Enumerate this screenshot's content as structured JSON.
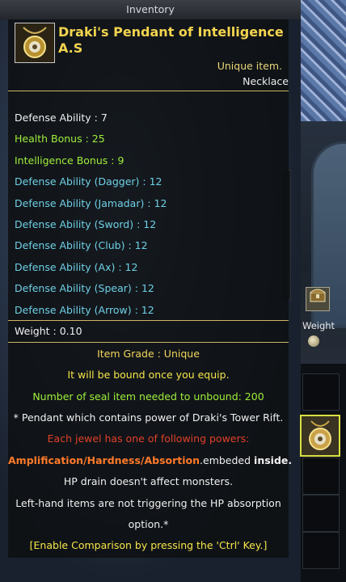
{
  "window": {
    "title": "Inventory"
  },
  "item": {
    "name": "Draki's Pendant of Intelligence A.S",
    "rarity": "Unique item.",
    "slot": "Necklace",
    "icon": "pendant-icon"
  },
  "stats": [
    {
      "text": "Defense Ability : 7",
      "color": "#f0f0f0"
    },
    {
      "text": "Health Bonus : 25",
      "color": "#9fef3b"
    },
    {
      "text": "Intelligence Bonus : 9",
      "color": "#9fef3b"
    },
    {
      "text": "Defense Ability (Dagger) : 12",
      "color": "#6fd0e6"
    },
    {
      "text": "Defense Ability (Jamadar) : 12",
      "color": "#6fd0e6"
    },
    {
      "text": "Defense Ability (Sword) : 12",
      "color": "#6fd0e6"
    },
    {
      "text": "Defense Ability (Club) : 12",
      "color": "#6fd0e6"
    },
    {
      "text": "Defense Ability (Ax) : 12",
      "color": "#6fd0e6"
    },
    {
      "text": "Defense Ability (Spear) : 12",
      "color": "#6fd0e6"
    },
    {
      "text": "Defense Ability (Arrow) : 12",
      "color": "#6fd0e6"
    }
  ],
  "weight": {
    "text": "Weight : 0.10"
  },
  "details": {
    "grade": "Item Grade : Unique",
    "bind": "It will be bound once you equip.",
    "seal": "Number of seal item needed to unbound: 200",
    "desc": "* Pendant which contains power of Draki's Tower Rift.",
    "jewel": "Each jewel has one of following powers:",
    "powers": "Amplification/Hardness/Absortion",
    "embedded": ".embeded ",
    "inside": "inside.",
    "drain": "HP drain doesn't affect monsters.",
    "lefthand1": "Left-hand items are not triggering the HP absorption",
    "lefthand2": "option.*",
    "compare": "[Enable Comparison by pressing the 'Ctrl' Key.]"
  },
  "side": {
    "weight_label": "Weight",
    "chest_icon": "chest-icon",
    "coin_icon": "weight-icon"
  },
  "colors": {
    "gold": "#f2d44f",
    "green": "#9fef3b",
    "cyan": "#6fd0e6",
    "red": "#e2402a",
    "orange": "#ff7a2a",
    "slot_highlight": "#d9e040"
  }
}
